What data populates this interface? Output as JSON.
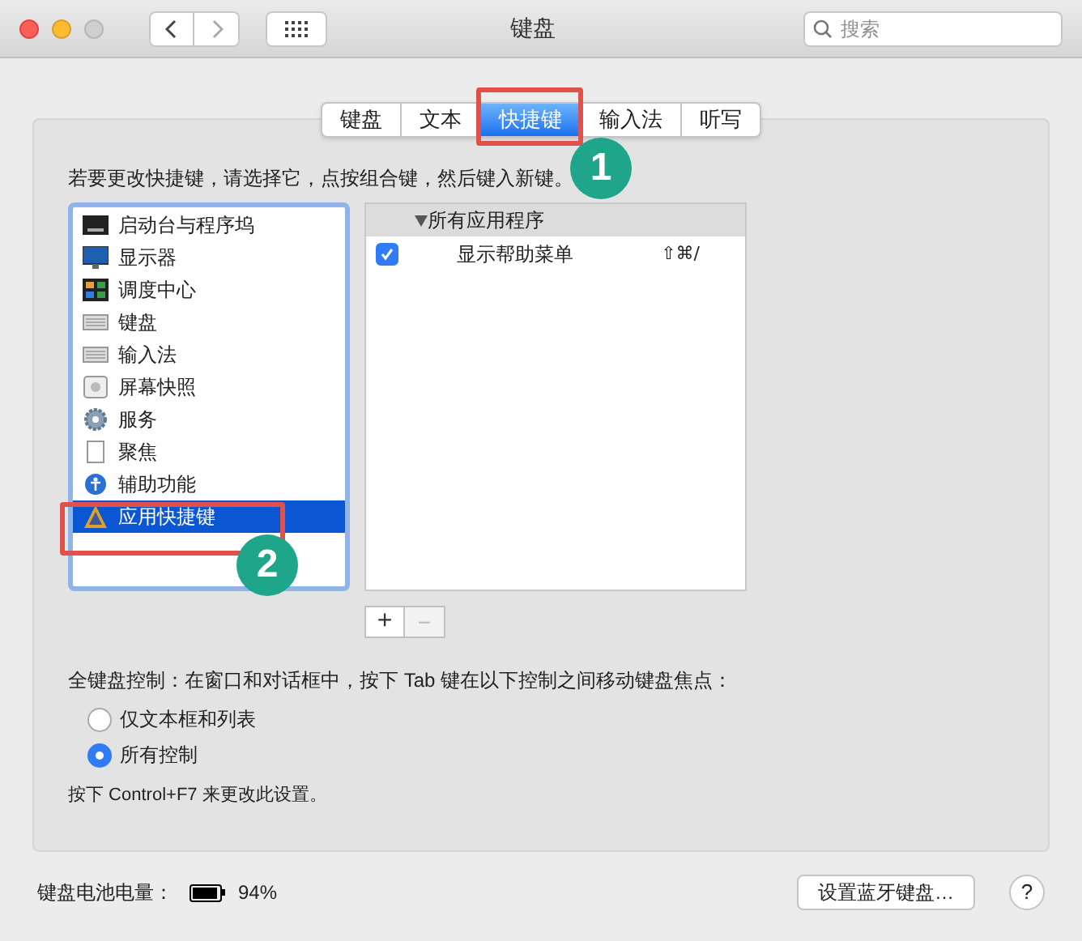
{
  "window": {
    "title": "键盘",
    "search_placeholder": "搜索"
  },
  "tabs": [
    {
      "label": "键盘",
      "selected": false
    },
    {
      "label": "文本",
      "selected": false
    },
    {
      "label": "快捷键",
      "selected": true
    },
    {
      "label": "输入法",
      "selected": false
    },
    {
      "label": "听写",
      "selected": false
    }
  ],
  "instruction": "若要更改快捷键，请选择它，点按组合键，然后键入新键。",
  "categories": [
    {
      "label": "启动台与程序坞",
      "kind": "dock",
      "selected": false
    },
    {
      "label": "显示器",
      "kind": "display",
      "selected": false
    },
    {
      "label": "调度中心",
      "kind": "mission",
      "selected": false
    },
    {
      "label": "键盘",
      "kind": "keyboard",
      "selected": false
    },
    {
      "label": "输入法",
      "kind": "keyboard",
      "selected": false
    },
    {
      "label": "屏幕快照",
      "kind": "screenshot",
      "selected": false
    },
    {
      "label": "服务",
      "kind": "gear",
      "selected": false
    },
    {
      "label": "聚焦",
      "kind": "spotlight",
      "selected": false
    },
    {
      "label": "辅助功能",
      "kind": "access",
      "selected": false
    },
    {
      "label": "应用快捷键",
      "kind": "app",
      "selected": true
    }
  ],
  "shortcuts": {
    "group": "所有应用程序",
    "expanded": true,
    "rows": [
      {
        "label": "显示帮助菜单",
        "keys": "⇧⌘/",
        "checked": true
      }
    ]
  },
  "add_button": "+",
  "remove_button": "−",
  "full_keyboard_access": {
    "label": "全键盘控制：在窗口和对话框中，按下 Tab 键在以下控制之间移动键盘焦点：",
    "options": [
      {
        "label": "仅文本框和列表",
        "selected": false
      },
      {
        "label": "所有控制",
        "selected": true
      }
    ],
    "hint": "按下 Control+F7 来更改此设置。"
  },
  "battery": {
    "label": "键盘电池电量：",
    "level": 0.94,
    "reading": "94%"
  },
  "setup_button": "设置蓝牙键盘…",
  "help_button": "?",
  "annotations": [
    {
      "label": "1"
    },
    {
      "label": "2"
    }
  ]
}
